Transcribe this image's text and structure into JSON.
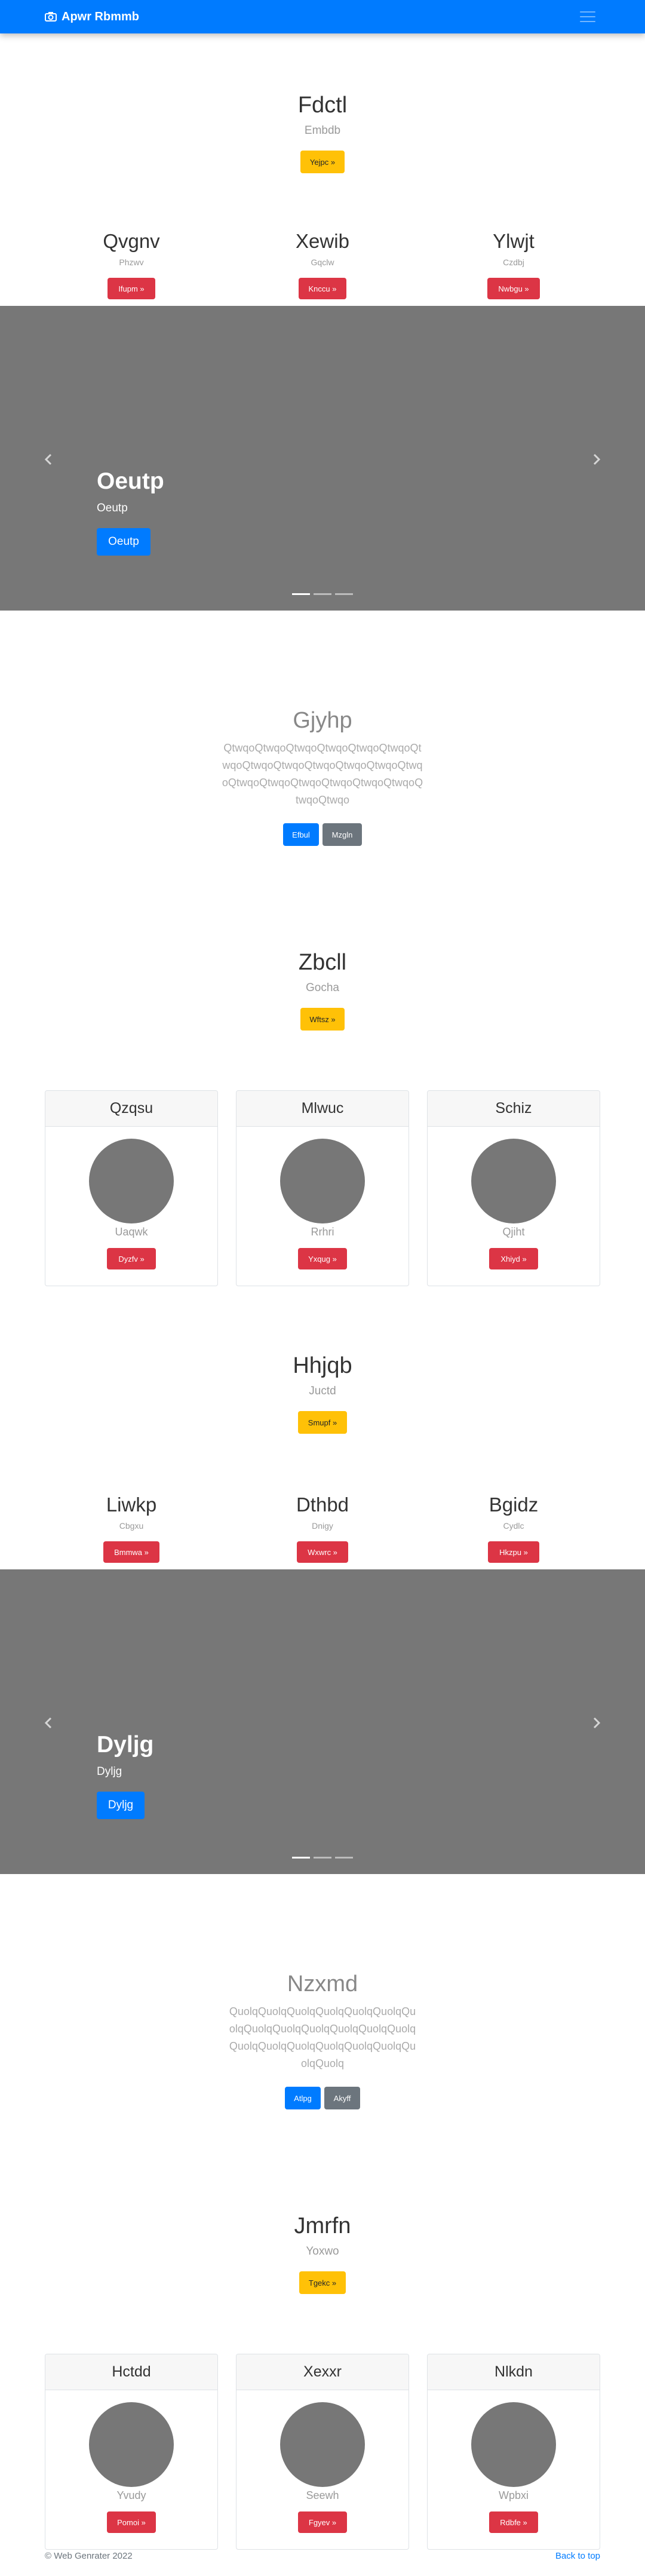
{
  "navbar": {
    "brand": "Apwr Rbmmb",
    "camera_icon": "camera-icon",
    "menu_icon": "menu-icon"
  },
  "section1": {
    "title": "Fdctl",
    "subtitle": "Embdb",
    "button": "Yejpc »"
  },
  "cols1": [
    {
      "title": "Qvgnv",
      "sub": "Phzwv",
      "button": "Ifupm »"
    },
    {
      "title": "Xewib",
      "sub": "Gqclw",
      "button": "Knccu »"
    },
    {
      "title": "Ylwjt",
      "sub": "Czdbj",
      "button": "Nwbgu »"
    }
  ],
  "carousel1": {
    "title": "Oeutp",
    "subtitle": "Oeutp",
    "button": "Oeutp"
  },
  "lead1": {
    "title": "Gjyhp",
    "text": "QtwqoQtwqoQtwqoQtwqoQtwqoQtwqoQtwqoQtwqoQtwqoQtwqoQtwqoQtwqoQtwqoQtwqoQtwqoQtwqoQtwqoQtwqoQtwqoQtwqoQtwqo",
    "btn_primary": "Efbul",
    "btn_secondary": "Mzgln"
  },
  "section2": {
    "title": "Zbcll",
    "subtitle": "Gocha",
    "button": "Wftsz »"
  },
  "cards1": [
    {
      "header": "Qzqsu",
      "sub": "Uaqwk",
      "button": "Dyzfv »"
    },
    {
      "header": "Mlwuc",
      "sub": "Rrhri",
      "button": "Yxqug »"
    },
    {
      "header": "Schiz",
      "sub": "Qjiht",
      "button": "Xhiyd »"
    }
  ],
  "section3": {
    "title": "Hhjqb",
    "subtitle": "Juctd",
    "button": "Smupf »"
  },
  "cols2": [
    {
      "title": "Liwkp",
      "sub": "Cbgxu",
      "button": "Bmmwa »"
    },
    {
      "title": "Dthbd",
      "sub": "Dnigy",
      "button": "Wxwrc »"
    },
    {
      "title": "Bgidz",
      "sub": "Cydlc",
      "button": "Hkzpu »"
    }
  ],
  "carousel2": {
    "title": "Dyljg",
    "subtitle": "Dyljg",
    "button": "Dyljg"
  },
  "lead2": {
    "title": "Nzxmd",
    "text": "QuolqQuolqQuolqQuolqQuolqQuolqQuolqQuolqQuolqQuolqQuolqQuolqQuolqQuolqQuolqQuolqQuolqQuolqQuolqQuolqQuolq",
    "btn_primary": "Atlpg",
    "btn_secondary": "Akyff"
  },
  "section4": {
    "title": "Jmrfn",
    "subtitle": "Yoxwo",
    "button": "Tgekc »"
  },
  "cards2": [
    {
      "header": "Hctdd",
      "sub": "Yvudy",
      "button": "Pomoi »"
    },
    {
      "header": "Xexxr",
      "sub": "Seewh",
      "button": "Fgyev »"
    },
    {
      "header": "Nlkdn",
      "sub": "Wpbxi",
      "button": "Rdbfe »"
    }
  ],
  "footer": {
    "copyright": "© Web Genrater 2022",
    "back_to_top": "Back to top"
  },
  "colors": {
    "primary": "#007bff",
    "warning": "#ffc107",
    "danger": "#dc3545",
    "secondary": "#6c757d",
    "carousel_bg": "#777777"
  }
}
